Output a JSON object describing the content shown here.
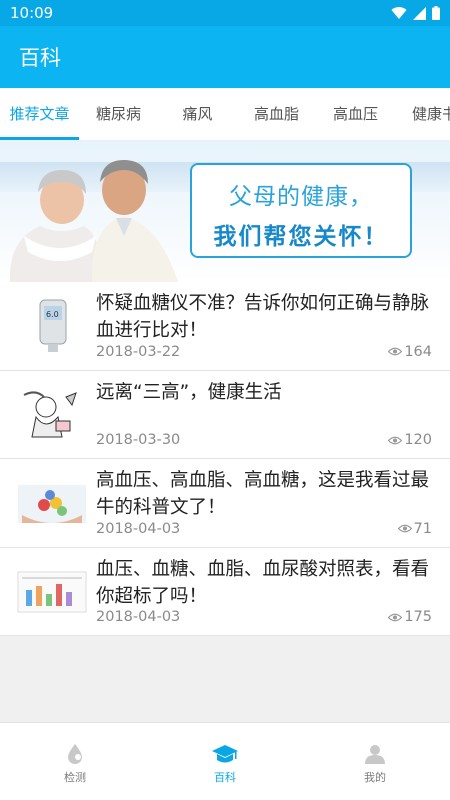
{
  "statusbar": {
    "time": "10:09"
  },
  "appbar": {
    "title": "百科"
  },
  "tabs": [
    {
      "label": "推荐文章",
      "active": true
    },
    {
      "label": "糖尿病",
      "active": false
    },
    {
      "label": "痛风",
      "active": false
    },
    {
      "label": "高血脂",
      "active": false
    },
    {
      "label": "高血压",
      "active": false
    },
    {
      "label": "健康书",
      "active": false
    }
  ],
  "banner": {
    "line1": "父母的健康，",
    "line2": "我们帮您关怀！"
  },
  "articles": [
    {
      "title": "怀疑血糖仪不准？告诉你如何正确与静脉血进行比对！",
      "date": "2018-03-22",
      "views": "164",
      "thumb": "glucose-meter"
    },
    {
      "title": "远离“三高”，健康生活",
      "date": "2018-03-30",
      "views": "120",
      "thumb": "cartoon"
    },
    {
      "title": "高血压、高血脂、高血糖，这是我看过最牛的科普文了！",
      "date": "2018-04-03",
      "views": "71",
      "thumb": "pills-hands"
    },
    {
      "title": "血压、血糖、血脂、血尿酸对照表，看看你超标了吗！",
      "date": "2018-04-03",
      "views": "175",
      "thumb": "chart-table"
    }
  ],
  "bottomnav": [
    {
      "label": "检测",
      "icon": "drop-icon",
      "active": false
    },
    {
      "label": "百科",
      "icon": "graduation-cap-icon",
      "active": true
    },
    {
      "label": "我的",
      "icon": "user-icon",
      "active": false
    }
  ],
  "colors": {
    "primary": "#0db4f2",
    "statusbar": "#08a8e6",
    "accent": "#0aa6e6"
  }
}
